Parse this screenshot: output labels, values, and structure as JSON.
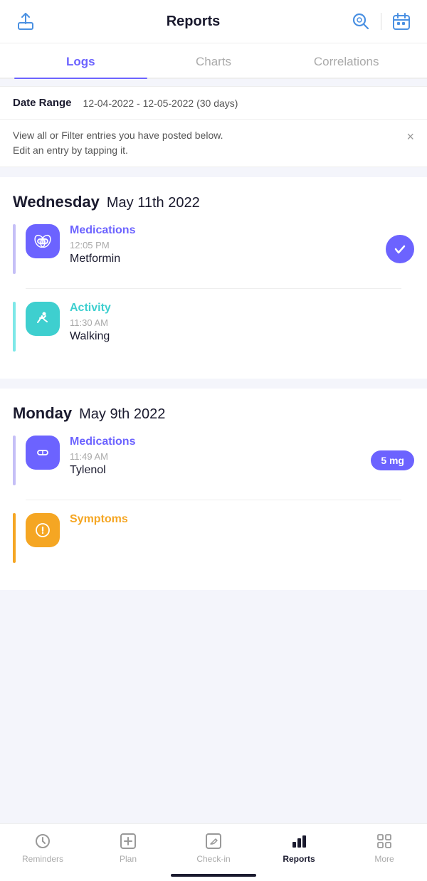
{
  "header": {
    "title": "Reports",
    "export_label": "export",
    "search_label": "search",
    "calendar_label": "calendar"
  },
  "tabs": [
    {
      "label": "Logs",
      "active": true
    },
    {
      "label": "Charts",
      "active": false
    },
    {
      "label": "Correlations",
      "active": false
    }
  ],
  "date_range": {
    "label": "Date Range",
    "value": "12-04-2022 - 12-05-2022 (30 days)"
  },
  "info_banner": {
    "text_line1": "View all or Filter entries you have posted below.",
    "text_line2": "Edit an entry by tapping it.",
    "close": "×"
  },
  "days": [
    {
      "day_name": "Wednesday",
      "day_date": "May 11th 2022",
      "entries": [
        {
          "category": "Medications",
          "category_color": "purple",
          "time": "12:05 PM",
          "name": "Metformin",
          "badge": "check"
        },
        {
          "category": "Activity",
          "category_color": "cyan",
          "time": "11:30 AM",
          "name": "Walking",
          "badge": "none"
        }
      ]
    },
    {
      "day_name": "Monday",
      "day_date": "May 9th 2022",
      "entries": [
        {
          "category": "Medications",
          "category_color": "purple",
          "time": "11:49 AM",
          "name": "Tylenol",
          "badge": "5 mg"
        },
        {
          "category": "Symptoms",
          "category_color": "orange",
          "time": "",
          "name": "",
          "badge": "none"
        }
      ]
    }
  ],
  "bottom_nav": [
    {
      "label": "Reminders",
      "icon": "clock",
      "active": false
    },
    {
      "label": "Plan",
      "icon": "plus-square",
      "active": false
    },
    {
      "label": "Check-in",
      "icon": "edit",
      "active": false
    },
    {
      "label": "Reports",
      "icon": "bar-chart",
      "active": true
    },
    {
      "label": "More",
      "icon": "grid",
      "active": false
    }
  ]
}
